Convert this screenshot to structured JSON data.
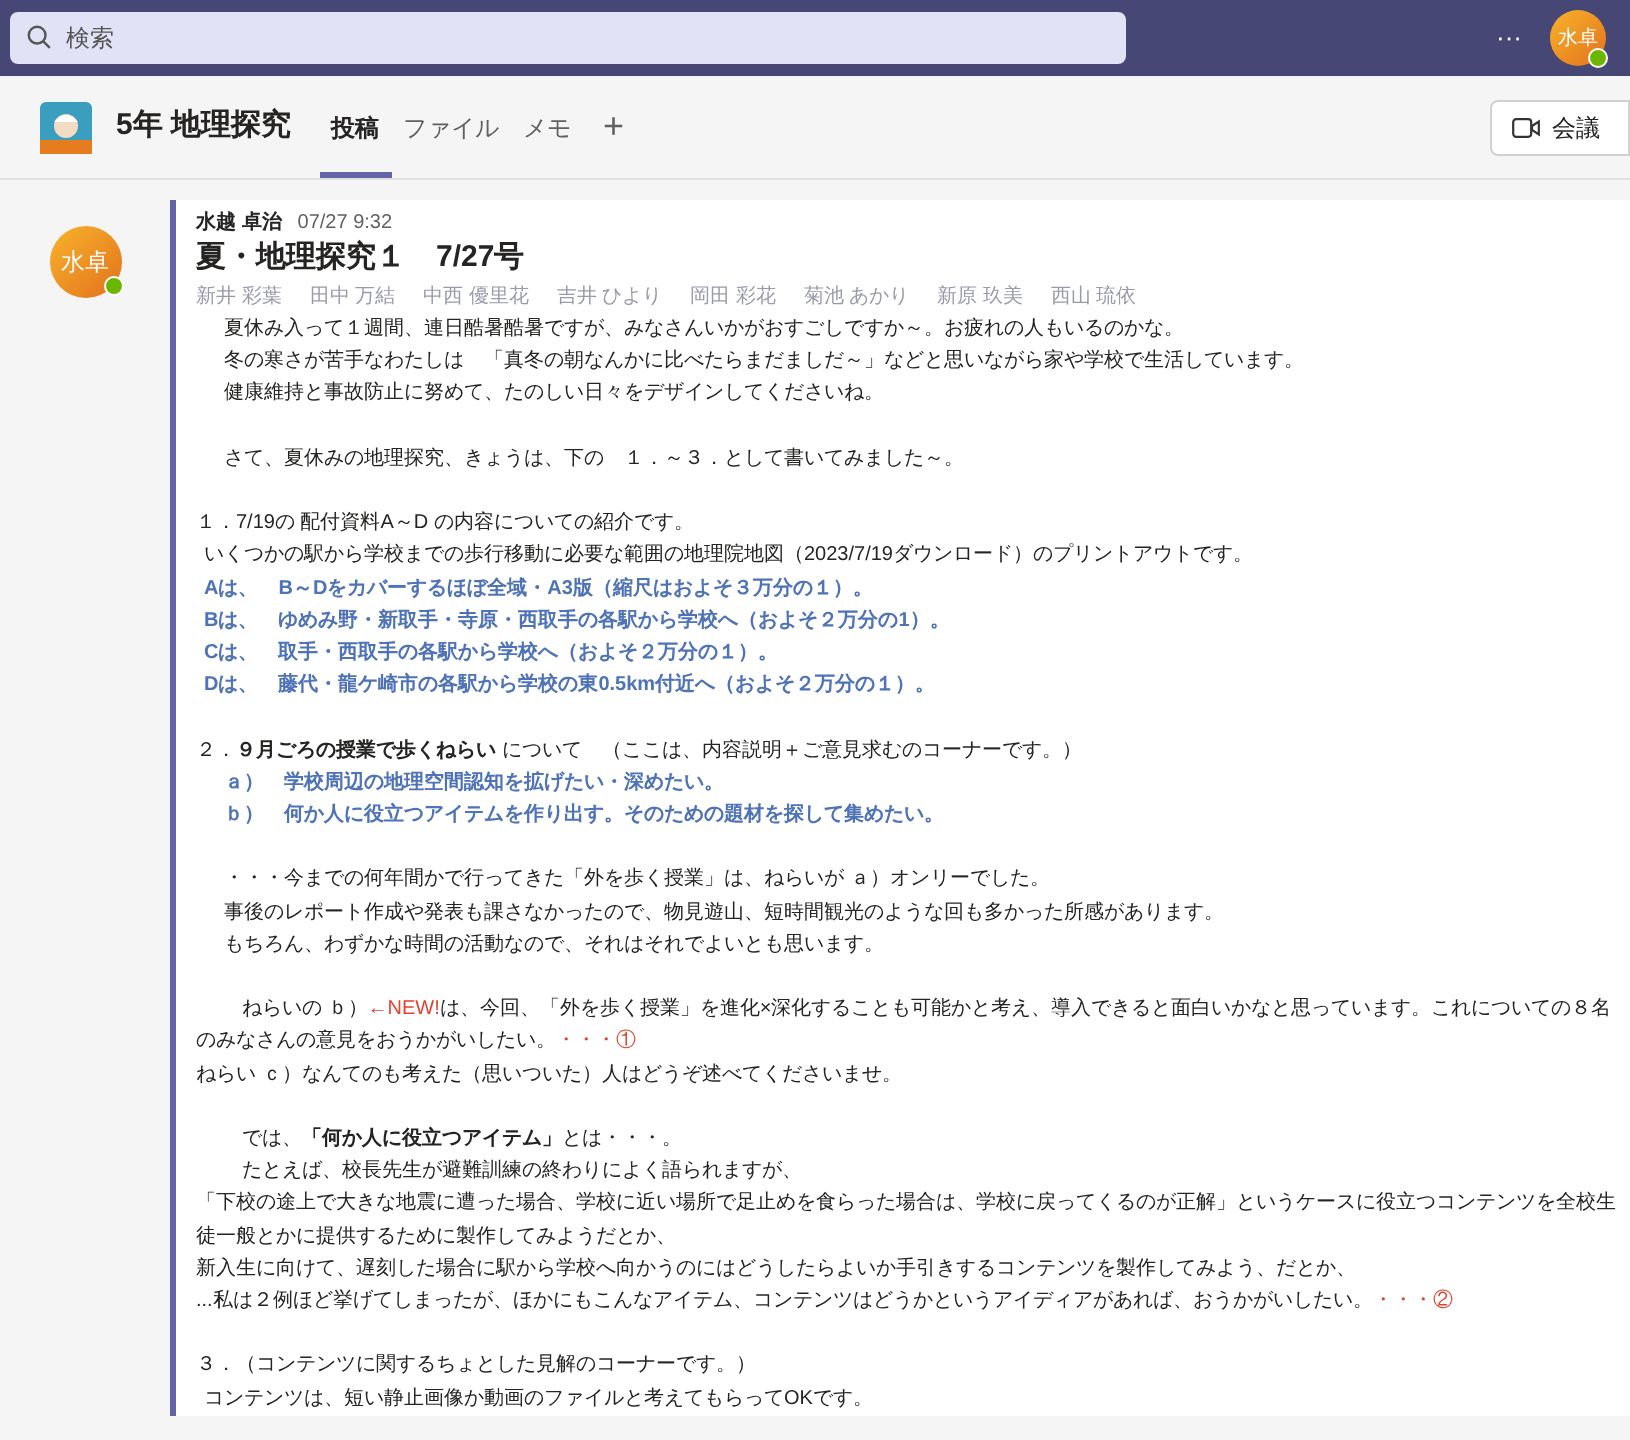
{
  "search": {
    "placeholder": "検索"
  },
  "top_bar": {
    "more": "···",
    "avatar_initials": "水卓"
  },
  "channel": {
    "name": "5年 地理探究",
    "tabs": [
      {
        "label": "投稿",
        "selected": true
      },
      {
        "label": "ファイル",
        "selected": false
      },
      {
        "label": "メモ",
        "selected": false
      }
    ],
    "add": "+",
    "meeting_button": "会議"
  },
  "post": {
    "avatar_initials": "水卓",
    "author": "水越 卓治",
    "time": "07/27 9:32",
    "title": "夏・地理探究１　7/27号",
    "mentions": [
      "新井 彩葉",
      "田中 万結",
      "中西 優里花",
      "吉井 ひより",
      "岡田 彩花",
      "菊池 あかり",
      "新原 玖美",
      "西山 琉依"
    ],
    "blocks": [
      [
        {
          "kind": "indent",
          "parts": [
            {
              "text": "夏休み入って１週間、連日酷暑酷暑ですが、みなさんいかがおすごしですか～。お疲れの人もいるのかな。",
              "kind": "plain"
            }
          ]
        },
        {
          "kind": "indent",
          "parts": [
            {
              "text": "冬の寒さが苦手なわたしは　「真冬の朝なんかに比べたらまだましだ～」などと思いながら家や学校で生活しています。",
              "kind": "plain"
            }
          ]
        },
        {
          "kind": "indent",
          "parts": [
            {
              "text": "健康維持と事故防止に努めて、たのしい日々をデザインしてくださいね。",
              "kind": "plain"
            }
          ]
        }
      ],
      [
        {
          "kind": "indent",
          "parts": [
            {
              "text": "さて、夏休みの地理探究、きょうは、下の　１．～３．として書いてみました～。",
              "kind": "plain"
            }
          ]
        }
      ],
      [
        {
          "kind": "flush",
          "parts": [
            {
              "text": "１．7/19の 配付資料A～D の内容についての紹介です。",
              "kind": "plain"
            }
          ]
        },
        {
          "kind": "sub",
          "parts": [
            {
              "text": "いくつかの駅から学校までの歩行移動に必要な範囲の地理院地図（2023/7/19ダウンロード）のプリントアウトです。",
              "kind": "plain"
            }
          ]
        },
        {
          "kind": "sub",
          "parts": [
            {
              "text": "Aは、　B～Dをカバーするほぼ全域・A3版（縮尺はおよそ３万分の１）。",
              "kind": "blue"
            }
          ]
        },
        {
          "kind": "sub",
          "parts": [
            {
              "text": "Bは、　ゆめみ野・新取手・寺原・西取手の各駅から学校へ（およそ２万分の1）。",
              "kind": "blue"
            }
          ]
        },
        {
          "kind": "sub",
          "parts": [
            {
              "text": "Cは、　取手・西取手の各駅から学校へ（およそ２万分の１）。",
              "kind": "blue"
            }
          ]
        },
        {
          "kind": "sub",
          "parts": [
            {
              "text": "Dは、　藤代・龍ケ崎市の各駅から学校の東0.5km付近へ（およそ２万分の１）。",
              "kind": "blue"
            }
          ]
        }
      ],
      [
        {
          "kind": "flush",
          "parts": [
            {
              "text": "２．",
              "kind": "plain"
            },
            {
              "text": "９月ごろの授業で歩くねらい",
              "kind": "bold"
            },
            {
              "text": " について　（ここは、内容説明＋ご意見求むのコーナーです。）",
              "kind": "plain"
            }
          ]
        },
        {
          "kind": "indent",
          "parts": [
            {
              "text": "ａ）　学校周辺の地理空間認知を拡げたい・深めたい。",
              "kind": "blue"
            }
          ]
        },
        {
          "kind": "indent",
          "parts": [
            {
              "text": "ｂ）　何か人に役立つアイテムを作り出す。そのための題材を探して集めたい。",
              "kind": "blue"
            }
          ]
        }
      ],
      [
        {
          "kind": "indent",
          "parts": [
            {
              "text": "・・・今までの何年間かで行ってきた「外を歩く授業」は、ねらいが ａ）オンリーでした。",
              "kind": "plain"
            }
          ]
        },
        {
          "kind": "indent",
          "parts": [
            {
              "text": "事後のレポート作成や発表も課さなかったので、物見遊山、短時間観光のような回も多かった所感があります。",
              "kind": "plain"
            }
          ]
        },
        {
          "kind": "indent",
          "parts": [
            {
              "text": "もちろん、わずかな時間の活動なので、それはそれでよいとも思います。",
              "kind": "plain"
            }
          ]
        }
      ],
      [
        {
          "kind": "para",
          "parts": [
            {
              "text": "ねらいの ｂ）",
              "kind": "plain"
            },
            {
              "text": "←NEW!",
              "kind": "red"
            },
            {
              "text": "は、今回、「外を歩く授業」を進化×深化することも可能かと考え、導入できると面白いかなと思っています。これについての８名のみなさんの意見をおうかがいしたい。",
              "kind": "plain"
            },
            {
              "text": "・・・①",
              "kind": "red"
            }
          ]
        },
        {
          "kind": "flush",
          "parts": [
            {
              "text": "ねらい ｃ）なんてのも考えた（思いついた）人はどうぞ述べてくださいませ。",
              "kind": "plain"
            }
          ]
        }
      ],
      [
        {
          "kind": "deep",
          "parts": [
            {
              "text": "では、",
              "kind": "plain"
            },
            {
              "text": "「何か人に役立つアイテム」",
              "kind": "bold"
            },
            {
              "text": "とは・・・。",
              "kind": "plain"
            }
          ]
        },
        {
          "kind": "deep",
          "parts": [
            {
              "text": "たとえば、校長先生が避難訓練の終わりによく語られますが、",
              "kind": "plain"
            }
          ]
        },
        {
          "kind": "flush",
          "parts": [
            {
              "text": "「下校の途上で大きな地震に遭った場合、学校に近い場所で足止めを食らった場合は、学校に戻ってくるのが正解」というケースに役立つコンテンツを全校生徒一般とかに提供するために製作してみようだとか、",
              "kind": "plain"
            }
          ]
        },
        {
          "kind": "flush",
          "parts": [
            {
              "text": "新入生に向けて、遅刻した場合に駅から学校へ向かうのにはどうしたらよいか手引きするコンテンツを製作してみよう、だとか、",
              "kind": "plain"
            }
          ]
        },
        {
          "kind": "flush",
          "parts": [
            {
              "text": "...私は２例ほど挙げてしまったが、ほかにもこんなアイテム、コンテンツはどうかというアイディアがあれば、おうかがいしたい。",
              "kind": "plain"
            },
            {
              "text": "・・・②",
              "kind": "red"
            }
          ]
        }
      ],
      [
        {
          "kind": "flush",
          "parts": [
            {
              "text": "３．（コンテンツに関するちょとした見解のコーナーです。）",
              "kind": "plain"
            }
          ]
        },
        {
          "kind": "sub",
          "parts": [
            {
              "text": "コンテンツは、短い静止画像か動画のファイルと考えてもらってOKです。",
              "kind": "plain"
            }
          ]
        }
      ]
    ]
  }
}
